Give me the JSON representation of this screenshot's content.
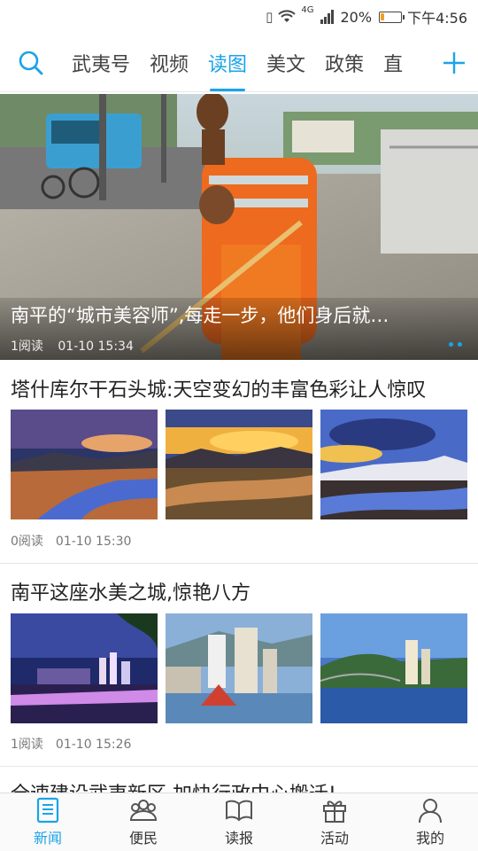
{
  "status_bar": {
    "battery_percent": "20%",
    "battery_level": 0.2,
    "network": "4G",
    "time": "下午4:56"
  },
  "top_nav": {
    "tabs": [
      {
        "label": "武夷号",
        "active": false
      },
      {
        "label": "视频",
        "active": false
      },
      {
        "label": "读图",
        "active": true
      },
      {
        "label": "美文",
        "active": false
      },
      {
        "label": "政策",
        "active": false
      },
      {
        "label": "直",
        "active": false
      }
    ],
    "search_icon": "search-icon",
    "add_icon": "plus-icon",
    "accent_color": "#1aa3e8"
  },
  "hero": {
    "title": "南平的“城市美容师”,每走一步，他们身后就…",
    "reads": "1阅读",
    "time": "01-10 15:34"
  },
  "articles": [
    {
      "title": "塔什库尔干石头城:天空变幻的丰富色彩让人惊叹",
      "reads": "0阅读",
      "time": "01-10 15:30"
    },
    {
      "title": "南平这座水美之城,惊艳八方",
      "reads": "1阅读",
      "time": "01-10 15:26"
    },
    {
      "title": "全速建设武夷新区 加快行政中心搬迁!"
    }
  ],
  "tabbar": {
    "items": [
      {
        "label": "新闻",
        "icon": "news-icon",
        "active": true
      },
      {
        "label": "便民",
        "icon": "people-icon",
        "active": false
      },
      {
        "label": "读报",
        "icon": "book-icon",
        "active": false
      },
      {
        "label": "活动",
        "icon": "gift-icon",
        "active": false
      },
      {
        "label": "我的",
        "icon": "user-icon",
        "active": false
      }
    ]
  }
}
